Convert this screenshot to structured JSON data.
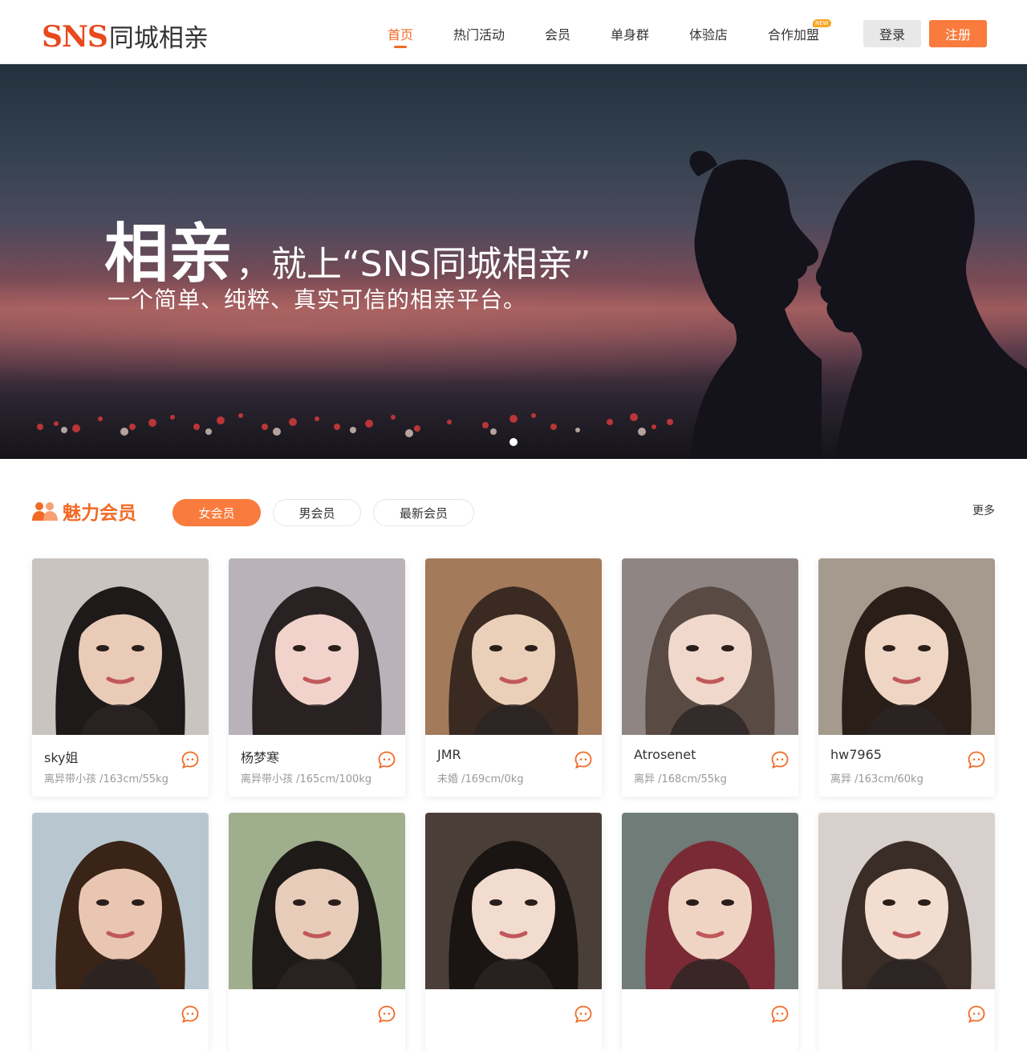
{
  "header": {
    "logo_brand": "SNS",
    "logo_text": "同城相亲",
    "nav": [
      {
        "label": "首页",
        "active": true
      },
      {
        "label": "热门活动",
        "active": false
      },
      {
        "label": "会员",
        "active": false
      },
      {
        "label": "单身群",
        "active": false
      },
      {
        "label": "体验店",
        "active": false
      },
      {
        "label": "合作加盟",
        "active": false,
        "badge": "NEW"
      }
    ],
    "login_label": "登录",
    "register_label": "注册"
  },
  "banner": {
    "title_big": "相亲",
    "title_rest": "，就上“SNS同城相亲”",
    "subtitle": "一个简单、纯粹、真实可信的相亲平台。"
  },
  "section": {
    "title": "魅力会员",
    "tabs": [
      {
        "label": "女会员",
        "active": true
      },
      {
        "label": "男会员",
        "active": false
      },
      {
        "label": "最新会员",
        "active": false
      }
    ],
    "more_label": "更多"
  },
  "members": [
    {
      "name": "sky姐",
      "desc": "离异带小孩 /163cm/55kg",
      "bg": "#c9c4c0",
      "hair": "#1e1a1a",
      "skin": "#e9cbb7"
    },
    {
      "name": "杨梦寒",
      "desc": "离异带小孩 /165cm/100kg",
      "bg": "#b9b2b8",
      "hair": "#2a2222",
      "skin": "#f1d3cb"
    },
    {
      "name": "JMR",
      "desc": "未婚 /169cm/0kg",
      "bg": "#a37a5a",
      "hair": "#3a2a22",
      "skin": "#ead0b8"
    },
    {
      "name": "Atrosenet",
      "desc": "离异 /168cm/55kg",
      "bg": "#8f8683",
      "hair": "#5a4a44",
      "skin": "#f0d8cc"
    },
    {
      "name": "hw7965",
      "desc": "离异 /163cm/60kg",
      "bg": "#a59a8e",
      "hair": "#2a1e18",
      "skin": "#efd6c4"
    },
    {
      "name": "",
      "desc": "",
      "bg": "#b8c7cf",
      "hair": "#3a2418",
      "skin": "#e9c6b2"
    },
    {
      "name": "",
      "desc": "",
      "bg": "#9fae8c",
      "hair": "#1e1a18",
      "skin": "#e7ccba"
    },
    {
      "name": "",
      "desc": "",
      "bg": "#4a3e38",
      "hair": "#1a1412",
      "skin": "#f1dccf"
    },
    {
      "name": "",
      "desc": "",
      "bg": "#6f7c78",
      "hair": "#7a2a34",
      "skin": "#efd4c4"
    },
    {
      "name": "",
      "desc": "",
      "bg": "#d8d0cc",
      "hair": "#3a2c26",
      "skin": "#f2ddd0"
    }
  ]
}
